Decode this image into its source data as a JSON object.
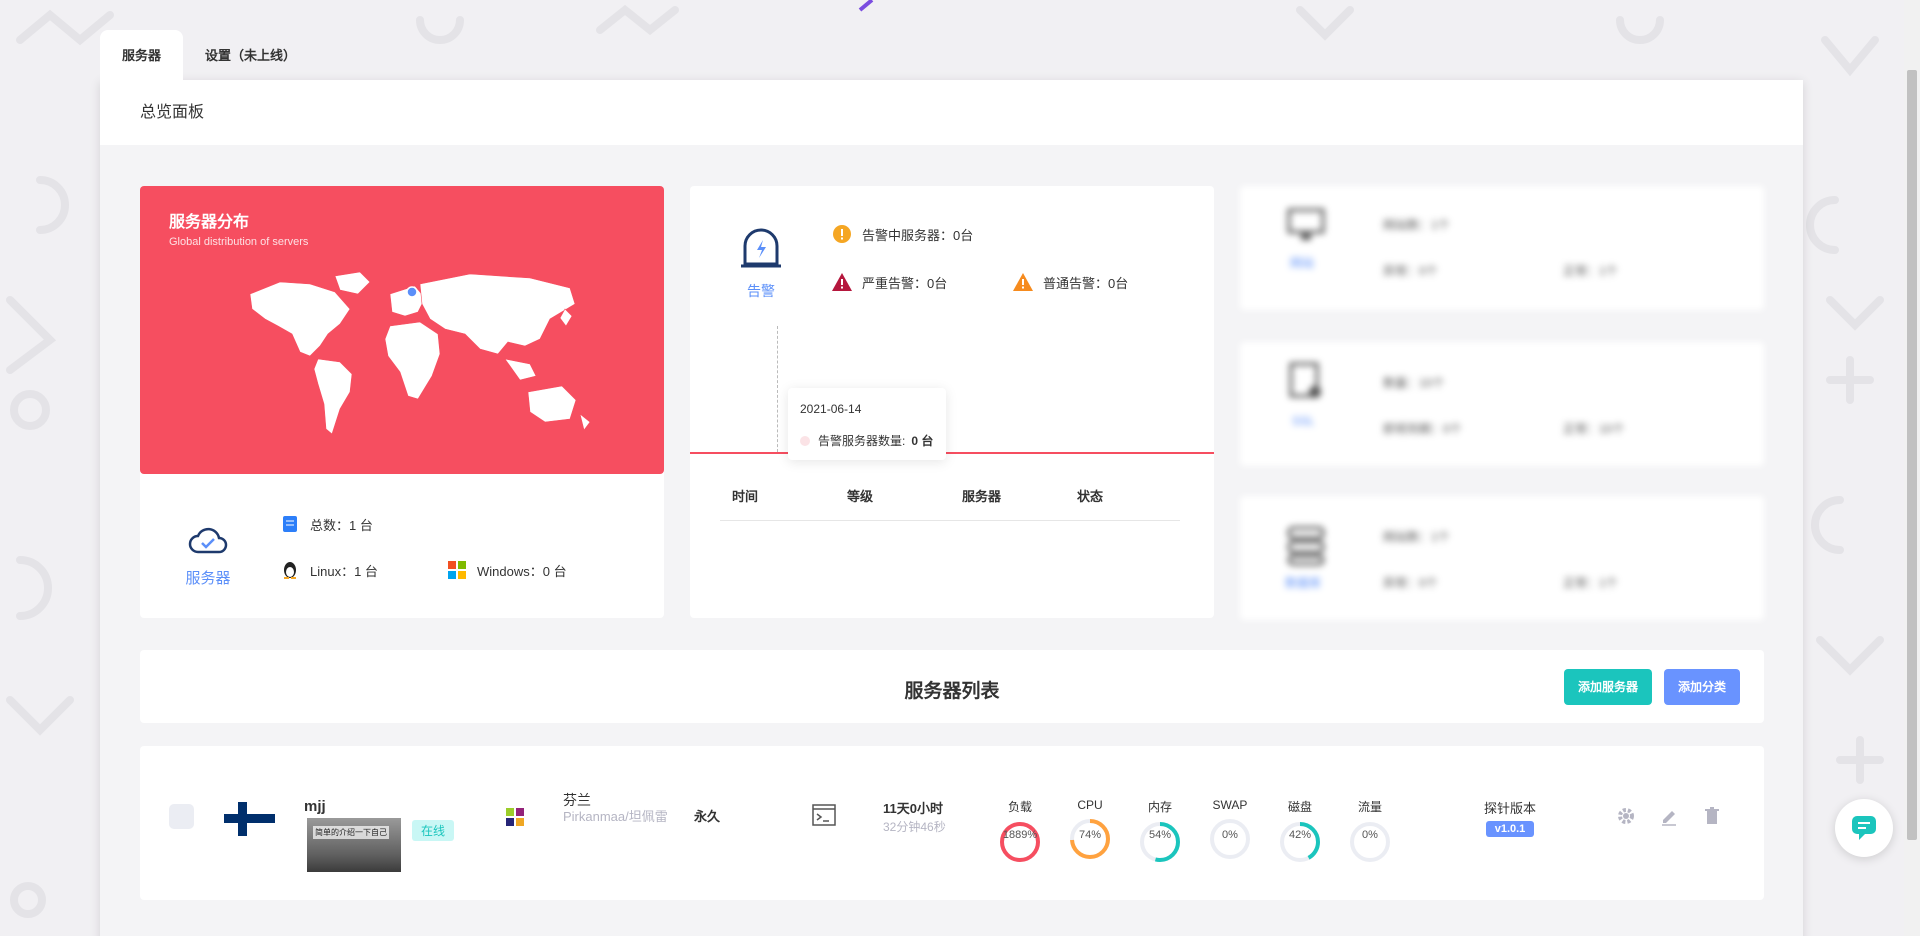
{
  "tabs": [
    {
      "label": "服务器"
    },
    {
      "label": "设置（未上线）"
    }
  ],
  "panel_title": "总览面板",
  "map_card": {
    "title": "服务器分布",
    "subtitle": "Global distribution of servers"
  },
  "server_summary": {
    "label": "服务器",
    "total": "总数：1 台",
    "linux": "Linux：1 台",
    "windows": "Windows：0 台"
  },
  "alerts": {
    "label": "告警",
    "alerting_servers": "告警中服务器：0台",
    "critical": "严重告警：0台",
    "normal": "普通告警：0台",
    "tooltip": {
      "date": "2021-06-14",
      "series": "告警服务器数量:",
      "value": "0 台"
    },
    "columns": [
      "时间",
      "等级",
      "服务器",
      "状态"
    ]
  },
  "blurred_cards": [
    {
      "label": "网站",
      "line1": "网站数：1个",
      "line2a": "异常：0个",
      "line2b": "正常：1个"
    },
    {
      "label": "SSL",
      "line1": "数量：10个",
      "line2a": "即将到期：0个",
      "line2b": "正常：10个"
    },
    {
      "label": "数据库",
      "line1": "网站数：1个",
      "line2a": "异常：0个",
      "line2b": "正常：1个"
    }
  ],
  "server_list": {
    "title": "服务器列表",
    "add_server": "添加服务器",
    "add_category": "添加分类"
  },
  "server_row": {
    "name": "mjj",
    "status": "在线",
    "thumb_text": "简单的介绍一下自己",
    "country": "芬兰",
    "region": "Pirkanmaa/坦佩雷",
    "expire": "永久",
    "uptime_main": "11天0小时",
    "uptime_sub": "32分钟46秒",
    "gauges": [
      {
        "label": "负载",
        "text": "1889%",
        "value": 1.0,
        "color": "#f64e60"
      },
      {
        "label": "CPU",
        "text": "74%",
        "value": 0.74,
        "color": "#ffa23f"
      },
      {
        "label": "内存",
        "text": "54%",
        "value": 0.54,
        "color": "#1bc5bd"
      },
      {
        "label": "SWAP",
        "text": "0%",
        "value": 0,
        "color": "#1bc5bd"
      },
      {
        "label": "磁盘",
        "text": "42%",
        "value": 0.42,
        "color": "#1bc5bd"
      },
      {
        "label": "流量",
        "text": "0%",
        "value": 0,
        "color": "#1bc5bd"
      }
    ],
    "probe_label": "探针版本",
    "probe_version": "v1.0.1"
  },
  "colors": {
    "accent_red": "#f64e60",
    "accent_blue": "#5b8ff9",
    "green": "#1bc5bd",
    "blue_btn": "#6993ff"
  }
}
